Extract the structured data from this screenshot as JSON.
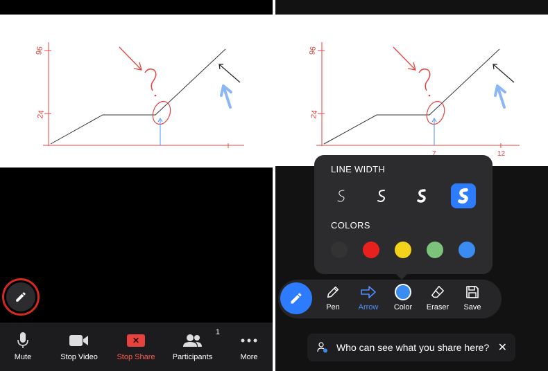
{
  "meeting_toolbar": {
    "mute_label": "Mute",
    "stop_video_label": "Stop Video",
    "stop_share_label": "Stop Share",
    "participants_label": "Participants",
    "participants_count": "1",
    "more_label": "More"
  },
  "whiteboard": {
    "y_labels": [
      "96",
      "24"
    ],
    "x_labels": [
      "7",
      "12"
    ]
  },
  "popup": {
    "line_width_title": "LINE WIDTH",
    "colors_title": "COLORS",
    "line_widths": [
      "thin",
      "medium",
      "thick",
      "extra-thick"
    ],
    "selected_line_width": "extra-thick",
    "colors": [
      "#333333",
      "#e8211f",
      "#f2d21a",
      "#7cc37b",
      "#3b8cf0"
    ]
  },
  "annotation_toolbar": {
    "pen_label": "Pen",
    "arrow_label": "Arrow",
    "color_label": "Color",
    "eraser_label": "Eraser",
    "save_label": "Save",
    "active_tool": "Arrow",
    "current_color": "#3b8cf0"
  },
  "toast": {
    "message": "Who can see what you share here?",
    "close_symbol": "✕"
  }
}
